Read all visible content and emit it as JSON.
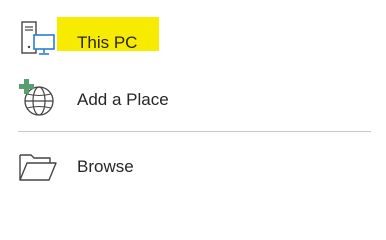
{
  "locations": {
    "this_pc": {
      "label": "This PC",
      "icon": "computer-icon",
      "highlight_color": "#f7ec00",
      "selected": true
    },
    "add_place": {
      "label": "Add a Place",
      "icon": "globe-add-icon",
      "accent_color": "#5a9e6f"
    },
    "browse": {
      "label": "Browse",
      "icon": "folder-open-icon"
    }
  },
  "colors": {
    "monitor_accent": "#2b7fd1",
    "text": "#262626",
    "divider": "#c8c8c8"
  }
}
